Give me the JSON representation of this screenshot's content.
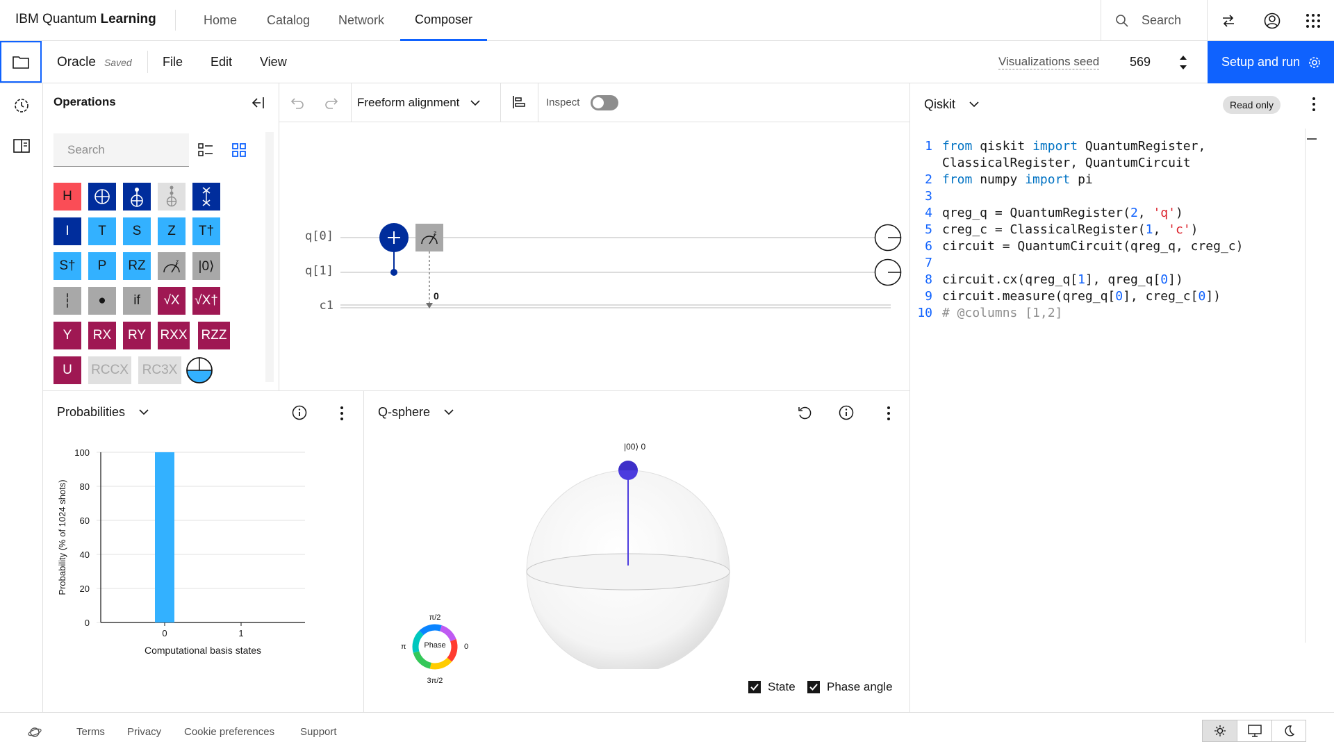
{
  "brand": {
    "prefix": "IBM Quantum ",
    "bold": "Learning"
  },
  "topnav": [
    "Home",
    "Catalog",
    "Network",
    "Composer"
  ],
  "search": {
    "label": "Search"
  },
  "file": {
    "name": "Oracle",
    "status": "Saved",
    "menus": [
      "File",
      "Edit",
      "View"
    ]
  },
  "seed": {
    "label": "Visualizations seed",
    "value": "569"
  },
  "setup_run": {
    "label": "Setup and run"
  },
  "operations": {
    "title": "Operations",
    "search_placeholder": "Search",
    "gates": [
      [
        "H",
        "⊕",
        "",
        "",
        "⋈"
      ],
      [
        "I",
        "T",
        "S",
        "Z",
        "T†"
      ],
      [
        "S†",
        "P",
        "RZ",
        "",
        "|0⟩"
      ],
      [
        "┆",
        "●",
        "if",
        "√X",
        "√X†"
      ],
      [
        "Y",
        "RX",
        "RY",
        "RXX",
        "RZZ"
      ],
      [
        "U",
        "RCCX",
        "RC3X",
        ""
      ]
    ]
  },
  "toolbar": {
    "alignment": "Freeform alignment",
    "inspect": "Inspect"
  },
  "circuit": {
    "qubits": [
      "q[0]",
      "q[1]"
    ],
    "classical": "c1",
    "measure_bit": "0"
  },
  "code": {
    "language": "Qiskit",
    "badge": "Read only",
    "lines": [
      {
        "n": "1",
        "t": "from qiskit import QuantumRegister,"
      },
      {
        "n": "",
        "t": "ClassicalRegister, QuantumCircuit"
      },
      {
        "n": "2",
        "t": "from numpy import pi"
      },
      {
        "n": "3",
        "t": ""
      },
      {
        "n": "4",
        "t": "qreg_q = QuantumRegister(2, 'q')"
      },
      {
        "n": "5",
        "t": "creg_c = ClassicalRegister(1, 'c')"
      },
      {
        "n": "6",
        "t": "circuit = QuantumCircuit(qreg_q, creg_c)"
      },
      {
        "n": "7",
        "t": ""
      },
      {
        "n": "8",
        "t": "circuit.cx(qreg_q[1], qreg_q[0])"
      },
      {
        "n": "9",
        "t": "circuit.measure(qreg_q[0], creg_c[0])"
      },
      {
        "n": "10",
        "t": "# @columns [1,2]"
      }
    ]
  },
  "probabilities": {
    "title": "Probabilities"
  },
  "chart_data": {
    "type": "bar",
    "categories": [
      "0",
      "1"
    ],
    "values": [
      100,
      0
    ],
    "ylabel": "Probability (% of 1024 shots)",
    "xlabel": "Computational basis states",
    "ylim": [
      0,
      100
    ],
    "yticks": [
      0,
      20,
      40,
      60,
      80,
      100
    ],
    "color": "#33b1ff"
  },
  "qsphere": {
    "title": "Q-sphere",
    "state_label": "|00⟩ 0",
    "phase": {
      "center": "Phase",
      "top": "π/2",
      "left": "π",
      "right": "0",
      "bottom": "3π/2"
    },
    "checks": [
      {
        "label": "State",
        "checked": true
      },
      {
        "label": "Phase angle",
        "checked": true
      }
    ]
  },
  "footer": {
    "links": [
      "Terms",
      "Privacy",
      "Cookie preferences",
      "Support"
    ]
  }
}
